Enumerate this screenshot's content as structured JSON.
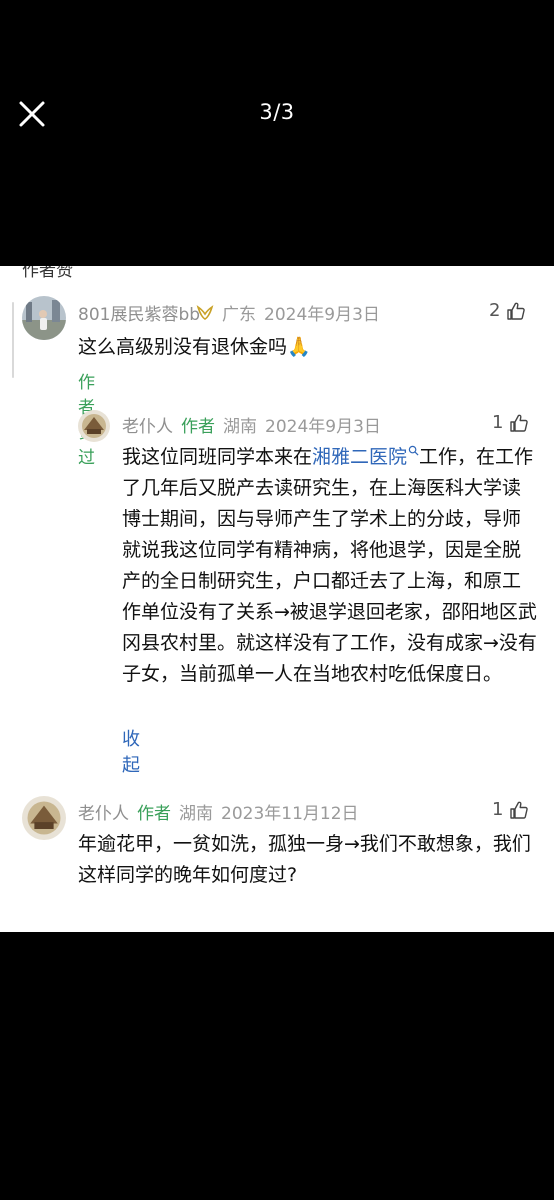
{
  "viewer": {
    "counter": "3/3"
  },
  "partial_text": "作者赞",
  "comments": [
    {
      "username": "801展民紫蓉bb",
      "location": "广东",
      "date": "2024年9月3日",
      "likes": "2",
      "text": "这么高级别没有退休金吗🙏",
      "author_liked": "作者赞过"
    },
    {
      "username": "老仆人",
      "author_tag": "作者",
      "location": "湖南",
      "date": "2024年9月3日",
      "likes": "1",
      "text_before_link": "我这位同班同学本来在",
      "link_text": "湘雅二医院",
      "text_after_link": "工作，在工作了几年后又脱产去读研究生，在上海医科大学读博士期间，因与导师产生了学术上的分歧，导师就说我这位同学有精神病，将他退学，因是全脱产的全日制研究生，户口都迁去了上海，和原工作单位没有了关系→被退学退回老家，邵阳地区武冈县农村里。就这样没有了工作，没有成家→没有子女，当前孤单一人在当地农村吃低保度日。",
      "collapse": "收起"
    },
    {
      "username": "老仆人",
      "author_tag": "作者",
      "location": "湖南",
      "date": "2023年11月12日",
      "likes": "1",
      "text": "年逾花甲，一贫如洗，孤独一身→我们不敢想象，我们这样同学的晚年如何度过?"
    }
  ]
}
